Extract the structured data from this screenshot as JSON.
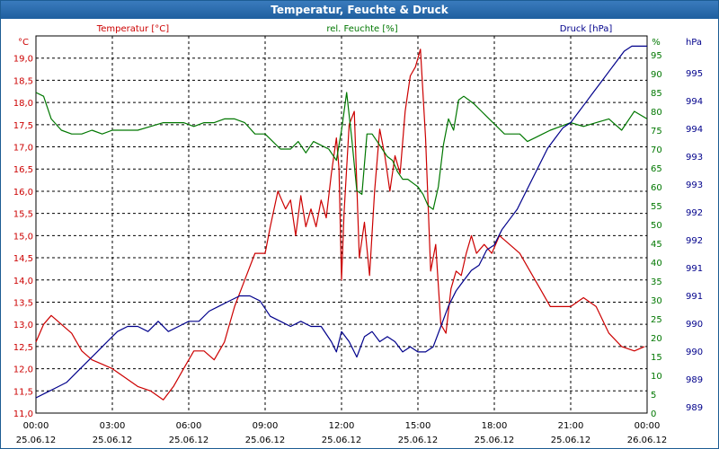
{
  "window": {
    "title": "Temperatur, Feuchte & Druck"
  },
  "colors": {
    "temperature": "#cc0000",
    "humidity": "#007700",
    "pressure": "#00008b",
    "grid": "#000000"
  },
  "chart_data": {
    "type": "line",
    "title": "Temperatur, Feuchte & Druck",
    "grid": true,
    "x_ticks": [
      {
        "hour": 0,
        "time": "00:00",
        "date": "25.06.12"
      },
      {
        "hour": 3,
        "time": "03:00",
        "date": "25.06.12"
      },
      {
        "hour": 6,
        "time": "06:00",
        "date": "25.06.12"
      },
      {
        "hour": 9,
        "time": "09:00",
        "date": "25.06.12"
      },
      {
        "hour": 12,
        "time": "12:00",
        "date": "25.06.12"
      },
      {
        "hour": 15,
        "time": "15:00",
        "date": "25.06.12"
      },
      {
        "hour": 18,
        "time": "18:00",
        "date": "25.06.12"
      },
      {
        "hour": 21,
        "time": "21:00",
        "date": "25.06.12"
      },
      {
        "hour": 24,
        "time": "00:00",
        "date": "26.06.12"
      }
    ],
    "axes": {
      "temperature": {
        "unit": "°C",
        "label": "Temperatur [°C]",
        "ylim": [
          11.0,
          19.5
        ],
        "ticks": [
          "11,0",
          "11,5",
          "12,0",
          "12,5",
          "13,0",
          "13,5",
          "14,0",
          "14,5",
          "15,0",
          "15,5",
          "16,0",
          "16,5",
          "17,0",
          "17,5",
          "18,0",
          "18,5",
          "19,0"
        ]
      },
      "humidity": {
        "unit": "%",
        "label": "rel. Feuchte [%]",
        "ylim": [
          0,
          100
        ],
        "ticks": [
          "0",
          "5",
          "10",
          "15",
          "20",
          "25",
          "30",
          "35",
          "40",
          "45",
          "50",
          "55",
          "60",
          "65",
          "70",
          "75",
          "80",
          "85",
          "90",
          "95"
        ]
      },
      "pressure": {
        "unit": "hPa",
        "label": "Druck [hPa]",
        "ylim": [
          988.6,
          996.0
        ],
        "ticks": [
          "989",
          "989",
          "990",
          "990",
          "991",
          "991",
          "992",
          "992",
          "993",
          "993",
          "994",
          "994",
          "995"
        ]
      }
    },
    "series": [
      {
        "name": "Temperatur [°C]",
        "axis": "temperature",
        "x": [
          0,
          0.3,
          0.6,
          1,
          1.4,
          1.8,
          2.2,
          2.6,
          3,
          3.5,
          4,
          4.5,
          5,
          5.4,
          5.8,
          6.2,
          6.6,
          7,
          7.4,
          7.8,
          8.2,
          8.6,
          9,
          9.2,
          9.5,
          9.8,
          10,
          10.2,
          10.4,
          10.6,
          10.8,
          11,
          11.2,
          11.4,
          11.6,
          11.8,
          11.9,
          12,
          12.1,
          12.3,
          12.5,
          12.7,
          12.9,
          13.1,
          13.3,
          13.5,
          13.7,
          13.9,
          14.1,
          14.3,
          14.5,
          14.7,
          14.9,
          15.1,
          15.3,
          15.5,
          15.7,
          15.9,
          16.1,
          16.3,
          16.5,
          16.7,
          16.9,
          17.1,
          17.3,
          17.6,
          17.9,
          18.2,
          18.6,
          19,
          19.4,
          19.8,
          20.2,
          20.6,
          21,
          21.5,
          22,
          22.5,
          23,
          23.5,
          23.9
        ],
        "values": [
          12.6,
          13.0,
          13.2,
          13.0,
          12.8,
          12.4,
          12.2,
          12.1,
          12.0,
          11.8,
          11.6,
          11.5,
          11.3,
          11.6,
          12.0,
          12.4,
          12.4,
          12.2,
          12.6,
          13.4,
          14.0,
          14.6,
          14.6,
          15.2,
          16.0,
          15.6,
          15.8,
          15.0,
          15.9,
          15.2,
          15.6,
          15.2,
          15.8,
          15.4,
          16.4,
          17.2,
          16.5,
          14.0,
          15.5,
          17.5,
          17.8,
          14.5,
          15.3,
          14.1,
          16.0,
          17.4,
          16.8,
          16.0,
          16.8,
          16.4,
          17.8,
          18.6,
          18.8,
          19.2,
          17.2,
          14.2,
          14.8,
          13.0,
          12.8,
          13.8,
          14.2,
          14.1,
          14.6,
          15.0,
          14.6,
          14.8,
          14.6,
          15.0,
          14.8,
          14.6,
          14.2,
          13.8,
          13.4,
          13.4,
          13.4,
          13.6,
          13.4,
          12.8,
          12.5,
          12.4,
          12.5
        ]
      },
      {
        "name": "rel. Feuchte [%]",
        "axis": "humidity",
        "x": [
          0,
          0.3,
          0.6,
          1,
          1.4,
          1.8,
          2.2,
          2.6,
          3,
          3.5,
          4,
          4.5,
          5,
          5.4,
          5.8,
          6.2,
          6.6,
          7,
          7.4,
          7.8,
          8.2,
          8.6,
          9,
          9.3,
          9.6,
          10,
          10.3,
          10.6,
          10.9,
          11.2,
          11.5,
          11.8,
          12,
          12.2,
          12.4,
          12.6,
          12.8,
          13.0,
          13.2,
          13.4,
          13.6,
          13.8,
          14.0,
          14.2,
          14.4,
          14.6,
          14.8,
          15.0,
          15.2,
          15.4,
          15.6,
          15.8,
          16,
          16.2,
          16.4,
          16.6,
          16.8,
          17.0,
          17.2,
          17.5,
          17.8,
          18.1,
          18.4,
          18.7,
          19,
          19.3,
          19.6,
          19.9,
          20.2,
          20.6,
          21,
          21.5,
          22,
          22.5,
          23,
          23.5,
          24
        ],
        "values": [
          85,
          84,
          78,
          75,
          74,
          74,
          75,
          74,
          75,
          75,
          75,
          76,
          77,
          77,
          77,
          76,
          77,
          77,
          78,
          78,
          77,
          74,
          74,
          72,
          70,
          70,
          72,
          69,
          72,
          71,
          70,
          67,
          75,
          85,
          73,
          59,
          58,
          74,
          74,
          72,
          70,
          68,
          67,
          64,
          62,
          62,
          61,
          60,
          58,
          55,
          54,
          60,
          71,
          78,
          75,
          83,
          84,
          83,
          82,
          80,
          78,
          76,
          74,
          74,
          74,
          72,
          73,
          74,
          75,
          76,
          77,
          76,
          77,
          78,
          75,
          80,
          78
        ]
      },
      {
        "name": "Druck [hPa]",
        "axis": "pressure",
        "x": [
          0,
          0.4,
          0.8,
          1.2,
          1.6,
          2,
          2.4,
          2.8,
          3.2,
          3.6,
          4,
          4.4,
          4.8,
          5.2,
          5.6,
          6,
          6.4,
          6.8,
          7.2,
          7.6,
          8,
          8.4,
          8.8,
          9.2,
          9.6,
          10,
          10.4,
          10.8,
          11.2,
          11.6,
          11.8,
          12,
          12.3,
          12.6,
          12.9,
          13.2,
          13.5,
          13.8,
          14.1,
          14.4,
          14.7,
          15,
          15.3,
          15.6,
          15.9,
          16.2,
          16.5,
          16.8,
          17.1,
          17.4,
          17.7,
          18,
          18.3,
          18.6,
          18.9,
          19.2,
          19.5,
          19.8,
          20.1,
          20.4,
          20.7,
          21,
          21.3,
          21.6,
          21.9,
          22.2,
          22.5,
          22.8,
          23.1,
          23.4,
          23.7,
          24
        ],
        "values": [
          988.9,
          989.0,
          989.1,
          989.2,
          989.4,
          989.6,
          989.8,
          990.0,
          990.2,
          990.3,
          990.3,
          990.2,
          990.4,
          990.2,
          990.3,
          990.4,
          990.4,
          990.6,
          990.7,
          990.8,
          990.9,
          990.9,
          990.8,
          990.5,
          990.4,
          990.3,
          990.4,
          990.3,
          990.3,
          990.0,
          989.8,
          990.2,
          990.0,
          989.7,
          990.1,
          990.2,
          990.0,
          990.1,
          990.0,
          989.8,
          989.9,
          989.8,
          989.8,
          989.9,
          990.3,
          990.7,
          991.0,
          991.2,
          991.4,
          991.5,
          991.8,
          991.9,
          992.2,
          992.4,
          992.6,
          992.9,
          993.2,
          993.5,
          993.8,
          994.0,
          994.2,
          994.3,
          994.5,
          994.7,
          994.9,
          995.1,
          995.3,
          995.5,
          995.7,
          995.8,
          995.8,
          995.8
        ]
      }
    ]
  }
}
